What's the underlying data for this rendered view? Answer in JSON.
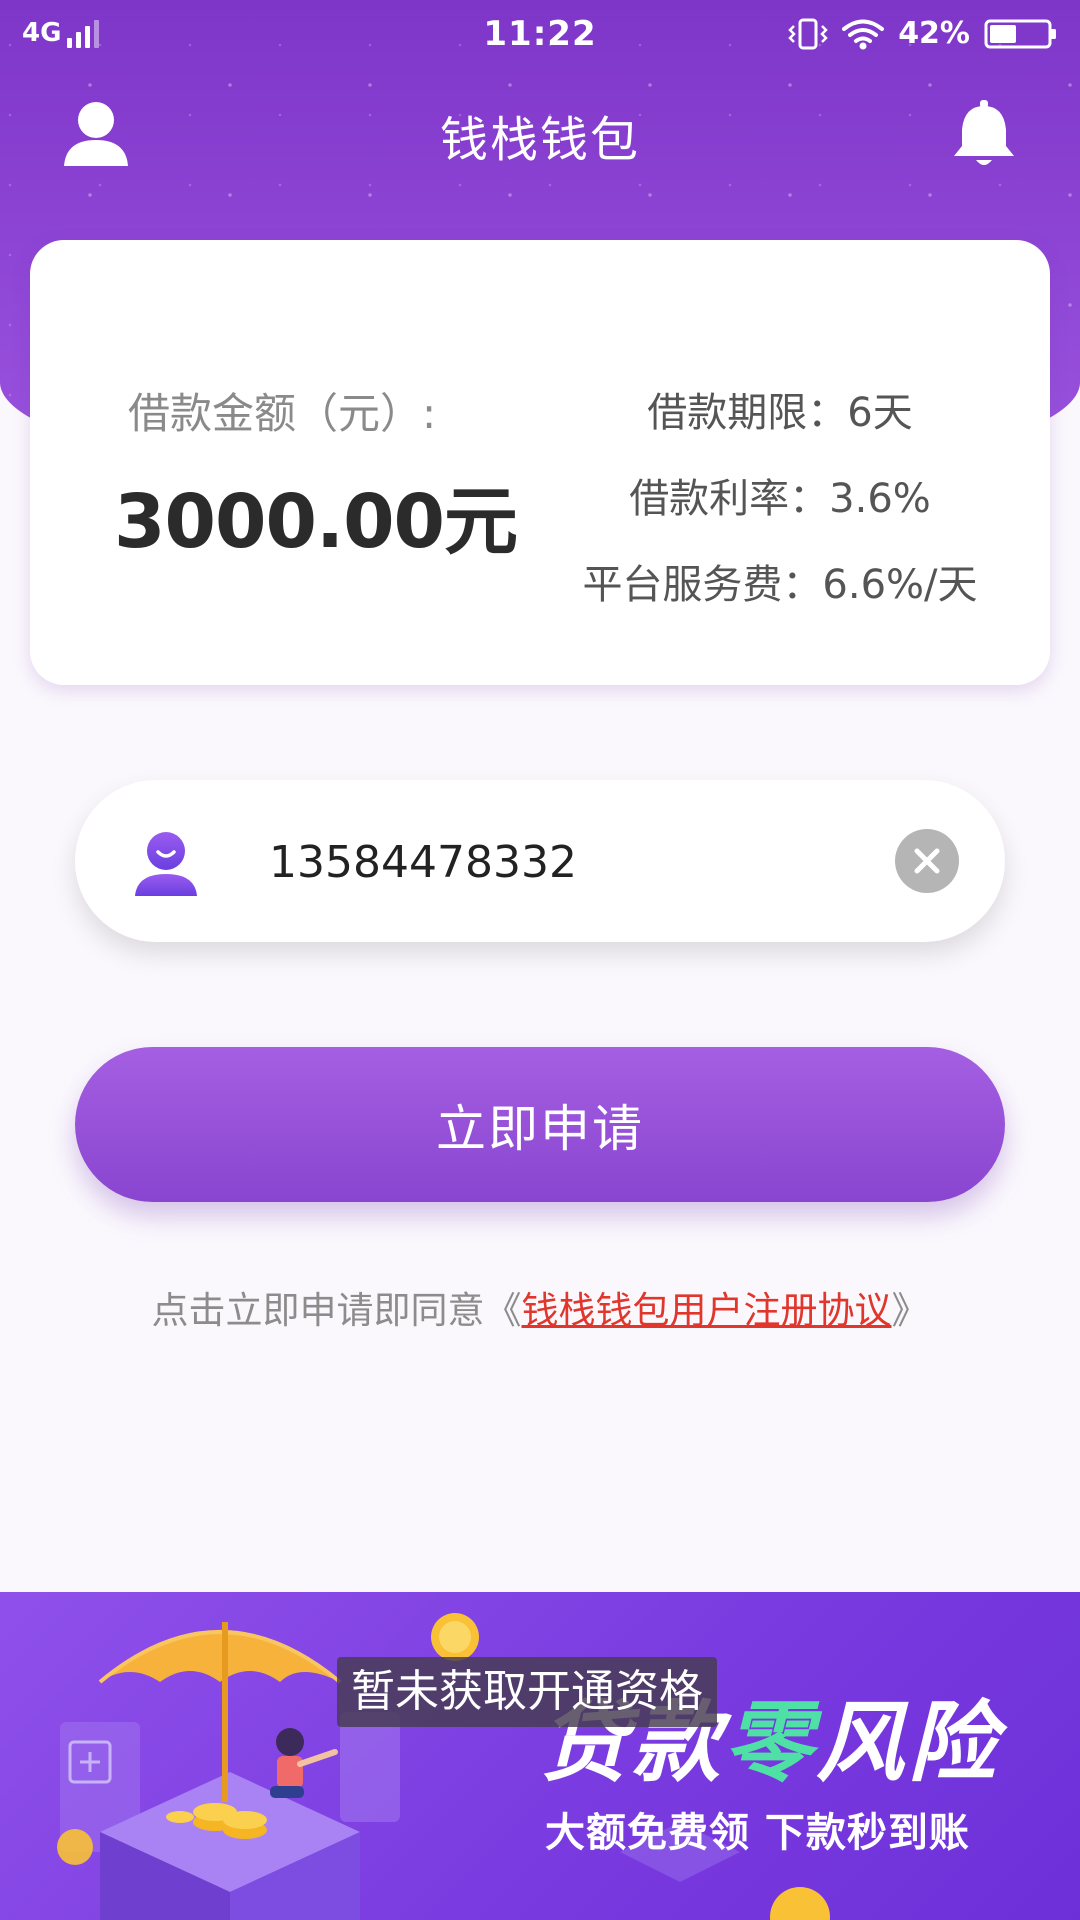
{
  "status_bar": {
    "network": "4G",
    "time": "11:22",
    "battery": "42%"
  },
  "header": {
    "title": "钱栈钱包"
  },
  "loan": {
    "amount_label": "借款金额（元）:",
    "amount_value": "3000.00元",
    "terms": [
      {
        "text": "借款期限：6天"
      },
      {
        "text": "借款利率：3.6%"
      },
      {
        "text": "平台服务费：6.6%/天"
      }
    ]
  },
  "phone_field": {
    "value": "13584478332"
  },
  "apply_button": {
    "label": "立即申请"
  },
  "agreement": {
    "prefix": "点击立即申请即同意",
    "open_quote": "《",
    "link": "钱栈钱包用户注册协议",
    "close_quote": "》"
  },
  "banner": {
    "headline_a": "贷款",
    "headline_accent": "零",
    "headline_b": "风险",
    "subtitle": "大额免费领 下款秒到账"
  },
  "toast": {
    "message": "暂未获取开通资格"
  },
  "colors": {
    "brand_purple": "#8a45d0",
    "link_red": "#e0362c",
    "accent_green": "#4fe0a6"
  },
  "icons": {
    "profile": "person-icon",
    "notification": "bell-icon",
    "field_user": "smiley-user-icon",
    "clear": "close-circle-icon"
  }
}
